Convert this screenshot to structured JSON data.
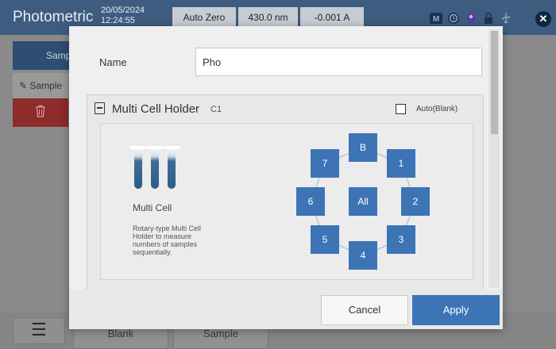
{
  "app": {
    "title": "Photometric",
    "date": "20/05/2024",
    "time": "12:24:55",
    "autozero_label": "Auto Zero",
    "wavelength": "430.0 nm",
    "absorbance": "-0.001 A",
    "status_icons": [
      "mb-icon",
      "clock-icon",
      "location-pin-icon",
      "lock-icon",
      "usb-icon"
    ],
    "close_icon": "close-icon"
  },
  "background": {
    "sample_tab": "Samp",
    "sample_row": "Sample",
    "delete_icon": "trash-icon",
    "menu_icon": "hamburger-menu-icon",
    "blank_button": "Blank",
    "sample_button": "Sample"
  },
  "dialog": {
    "name_label": "Name",
    "name_value": "Pho",
    "holder": {
      "title": "Multi Cell Holder",
      "code": "C1",
      "auto_blank_label": "Auto(Blank)",
      "auto_blank_checked": false,
      "cell_name": "Multi Cell",
      "description": "Rotary-type Multi Cell Holder to measure numbers of samples sequentially.",
      "cells": {
        "blank": "B",
        "all": "All",
        "c1": "1",
        "c2": "2",
        "c3": "3",
        "c4": "4",
        "c5": "5",
        "c6": "6",
        "c7": "7"
      }
    },
    "cancel_label": "Cancel",
    "apply_label": "Apply"
  },
  "colors": {
    "accent": "#3c74b6",
    "topbar": "#3d5c80",
    "delete": "#8e2b2b"
  }
}
